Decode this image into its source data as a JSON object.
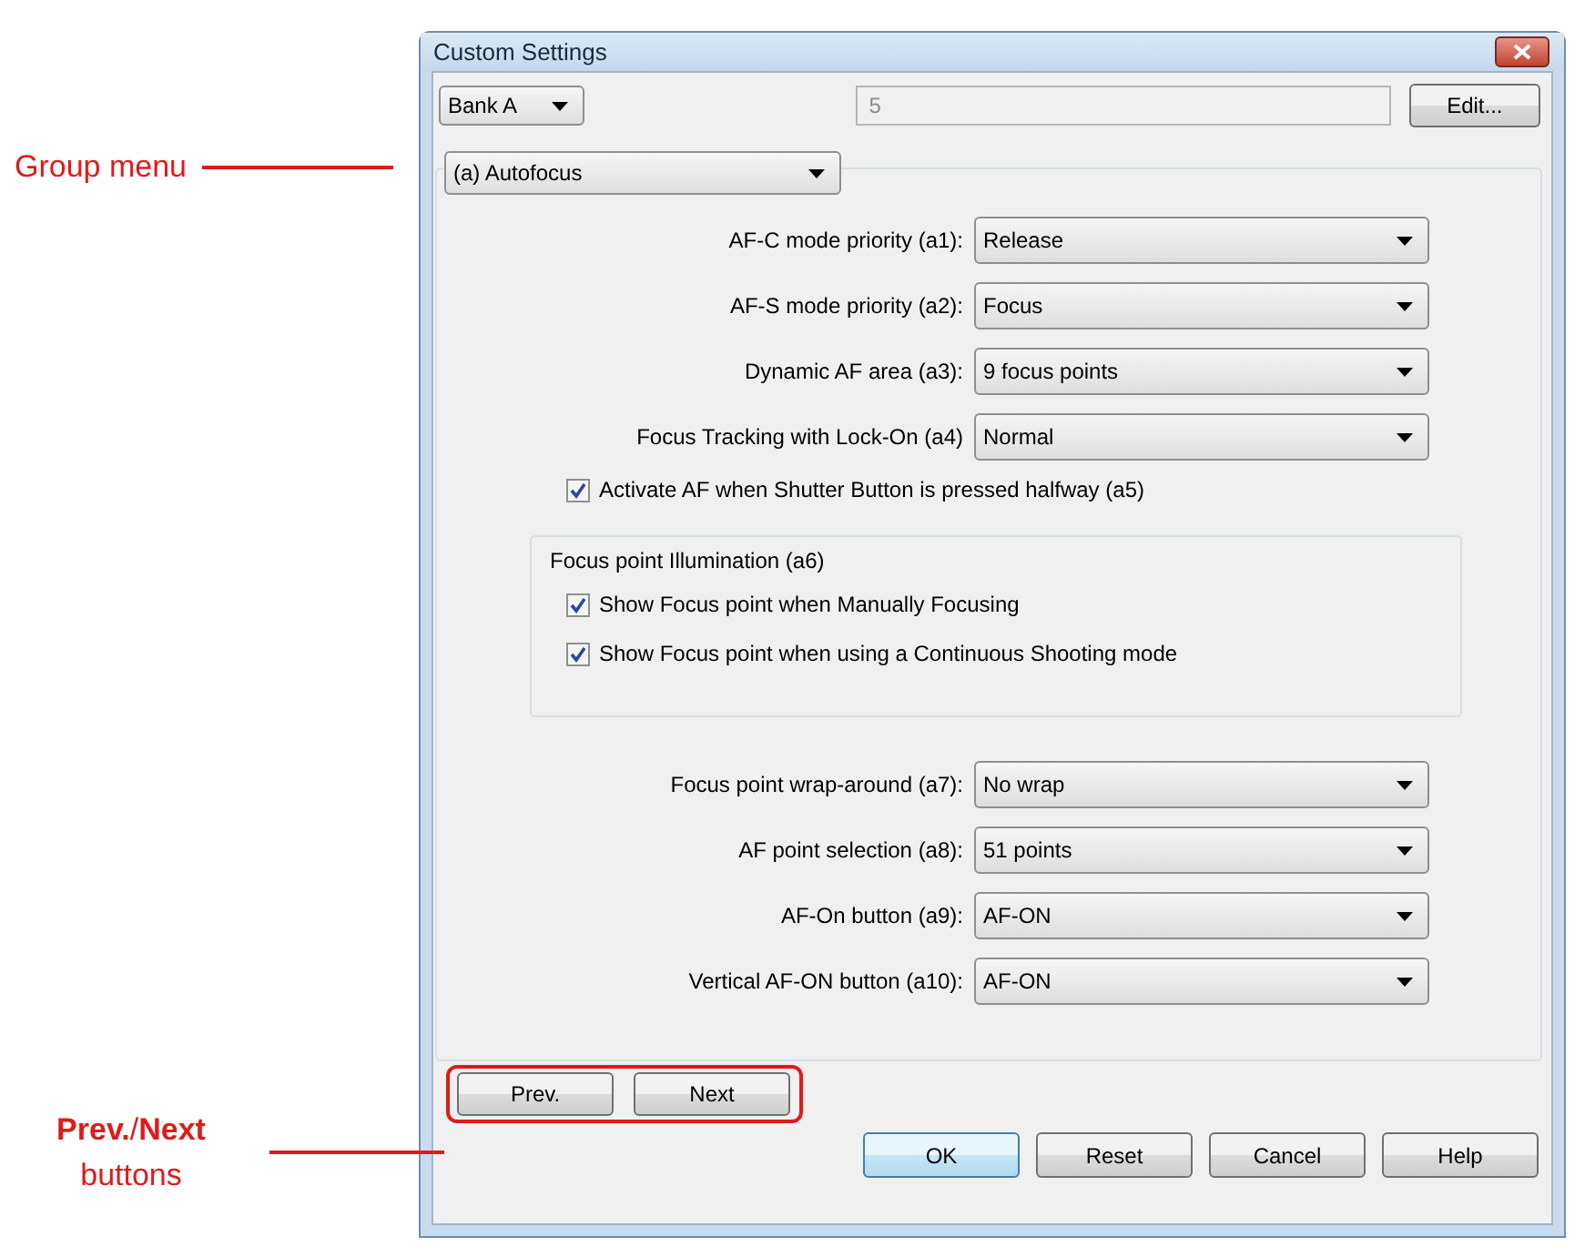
{
  "window": {
    "title": "Custom Settings"
  },
  "bank_dropdown": {
    "value": "Bank A"
  },
  "number_field": {
    "value": "5",
    "disabled": true
  },
  "edit_button": "Edit...",
  "group_dropdown": {
    "value": "(a) Autofocus"
  },
  "settings": [
    {
      "kind": "dropdown",
      "label": "AF-C mode priority (a1):",
      "value": "Release"
    },
    {
      "kind": "dropdown",
      "label": "AF-S mode priority (a2):",
      "value": "Focus"
    },
    {
      "kind": "dropdown",
      "label": "Dynamic AF area (a3):",
      "value": "9 focus points"
    },
    {
      "kind": "dropdown",
      "label": "Focus Tracking with Lock-On (a4)",
      "value": "Normal"
    },
    {
      "kind": "checkbox",
      "label": "Activate AF when Shutter Button is pressed halfway (a5)",
      "checked": true
    },
    {
      "kind": "group",
      "title": "Focus point Illumination (a6)",
      "children": [
        {
          "kind": "checkbox",
          "label": "Show Focus point when Manually Focusing",
          "checked": true
        },
        {
          "kind": "checkbox",
          "label": "Show Focus point when using a Continuous Shooting mode",
          "checked": true
        }
      ]
    },
    {
      "kind": "dropdown",
      "label": "Focus point wrap-around (a7):",
      "value": "No wrap"
    },
    {
      "kind": "dropdown",
      "label": "AF point selection (a8):",
      "value": "51 points"
    },
    {
      "kind": "dropdown",
      "label": "AF-On button (a9):",
      "value": "AF-ON"
    },
    {
      "kind": "dropdown",
      "label": "Vertical AF-ON button (a10):",
      "value": "AF-ON"
    }
  ],
  "nav_buttons": [
    {
      "label": "Prev."
    },
    {
      "label": "Next"
    }
  ],
  "footer_buttons": [
    {
      "label": "OK",
      "default": true
    },
    {
      "label": "Reset",
      "default": false
    },
    {
      "label": "Cancel",
      "default": false
    },
    {
      "label": "Help",
      "default": false
    }
  ],
  "annotations": [
    {
      "kind": "group",
      "text": "Group menu"
    },
    {
      "kind": "nav",
      "text": "**Prev.**/**Next**\nbuttons"
    }
  ]
}
